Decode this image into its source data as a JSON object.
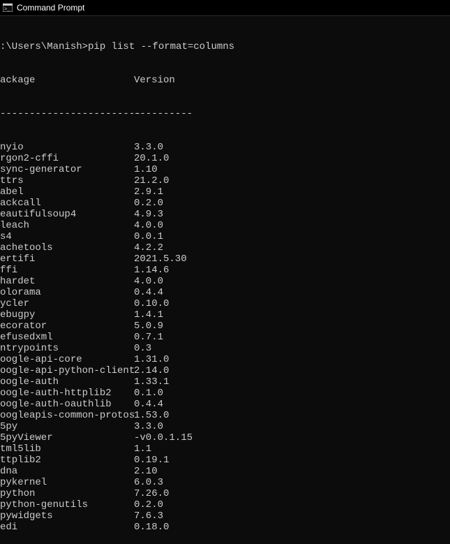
{
  "window": {
    "title": "Command Prompt"
  },
  "prompt_line": ":\\Users\\Manish>pip list --format=columns",
  "header": {
    "package": "ackage",
    "version": "Version"
  },
  "divider": {
    "package": "------------------------",
    "version": "----------"
  },
  "packages": [
    {
      "name": "nyio",
      "version": "3.3.0"
    },
    {
      "name": "rgon2-cffi",
      "version": "20.1.0"
    },
    {
      "name": "sync-generator",
      "version": "1.10"
    },
    {
      "name": "ttrs",
      "version": "21.2.0"
    },
    {
      "name": "abel",
      "version": "2.9.1"
    },
    {
      "name": "ackcall",
      "version": "0.2.0"
    },
    {
      "name": "eautifulsoup4",
      "version": "4.9.3"
    },
    {
      "name": "leach",
      "version": "4.0.0"
    },
    {
      "name": "s4",
      "version": "0.0.1"
    },
    {
      "name": "achetools",
      "version": "4.2.2"
    },
    {
      "name": "ertifi",
      "version": "2021.5.30"
    },
    {
      "name": "ffi",
      "version": "1.14.6"
    },
    {
      "name": "hardet",
      "version": "4.0.0"
    },
    {
      "name": "olorama",
      "version": "0.4.4"
    },
    {
      "name": "ycler",
      "version": "0.10.0"
    },
    {
      "name": "ebugpy",
      "version": "1.4.1"
    },
    {
      "name": "ecorator",
      "version": "5.0.9"
    },
    {
      "name": "efusedxml",
      "version": "0.7.1"
    },
    {
      "name": "ntrypoints",
      "version": "0.3"
    },
    {
      "name": "oogle-api-core",
      "version": "1.31.0"
    },
    {
      "name": "oogle-api-python-client",
      "version": "2.14.0"
    },
    {
      "name": "oogle-auth",
      "version": "1.33.1"
    },
    {
      "name": "oogle-auth-httplib2",
      "version": "0.1.0"
    },
    {
      "name": "oogle-auth-oauthlib",
      "version": "0.4.4"
    },
    {
      "name": "oogleapis-common-protos",
      "version": "1.53.0"
    },
    {
      "name": "5py",
      "version": "3.3.0"
    },
    {
      "name": "5pyViewer",
      "version": "-v0.0.1.15"
    },
    {
      "name": "tml5lib",
      "version": "1.1"
    },
    {
      "name": "ttplib2",
      "version": "0.19.1"
    },
    {
      "name": "dna",
      "version": "2.10"
    },
    {
      "name": "pykernel",
      "version": "6.0.3"
    },
    {
      "name": "python",
      "version": "7.26.0"
    },
    {
      "name": "python-genutils",
      "version": "0.2.0"
    },
    {
      "name": "pywidgets",
      "version": "7.6.3"
    },
    {
      "name": "edi",
      "version": "0.18.0"
    }
  ]
}
